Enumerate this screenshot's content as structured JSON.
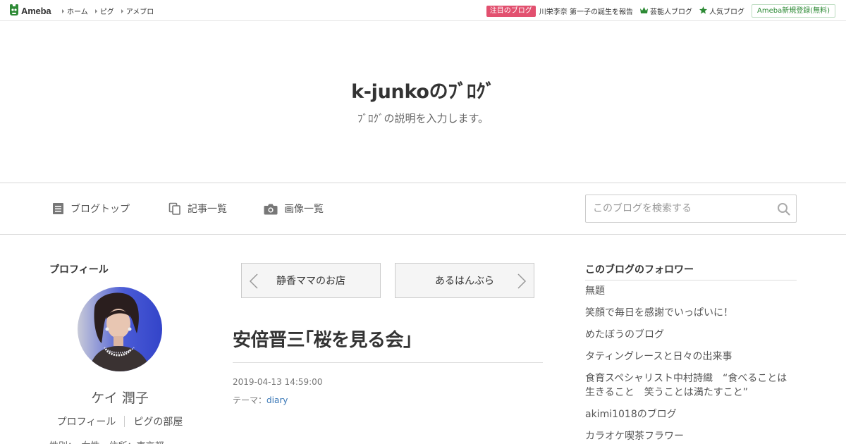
{
  "topbar": {
    "logo_text": "Ameba",
    "nav": [
      "ホーム",
      "ピグ",
      "アメブロ"
    ],
    "attention_badge": "注目のブログ",
    "attention_text": "川栄李奈 第一子の誕生を報告",
    "links": [
      {
        "label": "芸能人ブログ",
        "icon": "crown-icon"
      },
      {
        "label": "人気ブログ",
        "icon": "star-icon"
      }
    ],
    "signup_label": "Ameba新規登録(無料)",
    "brand_color": "#2d8a35"
  },
  "header": {
    "title": "k-junkoのﾌﾞﾛｸﾞ",
    "description": "ﾌﾞﾛｸﾞの説明を入力します。"
  },
  "nav": {
    "items": [
      {
        "label": "ブログトップ",
        "icon": "document-icon"
      },
      {
        "label": "記事一覧",
        "icon": "copy-icon"
      },
      {
        "label": "画像一覧",
        "icon": "camera-icon"
      }
    ],
    "search_placeholder": "このブログを検索する"
  },
  "profile": {
    "section_title": "プロフィール",
    "name": "ケイ 潤子",
    "links": [
      "プロフィール",
      "ピグの部屋"
    ],
    "extra": "性別：　女性　住所：東京都"
  },
  "pager": {
    "prev_label": "静香ママのお店",
    "next_label": "あるはんぶら"
  },
  "article": {
    "title": "安倍晋三｢桜を見る会｣",
    "date": "2019-04-13 14:59:00",
    "theme_label": "テーマ：",
    "theme_value": "diary",
    "link_color": "#3a78b7"
  },
  "followers": {
    "section_title": "このブログのフォロワー",
    "items": [
      "無題",
      "笑顔で毎日を感謝でいっぱいに！",
      "めたぼうのブログ",
      "タティングレースと日々の出来事",
      "食育スペシャリスト中村詩織　“食べることは生きること　笑うことは満たすこと”",
      "akimi1018のブログ",
      "カラオケ喫茶フラワー"
    ]
  }
}
